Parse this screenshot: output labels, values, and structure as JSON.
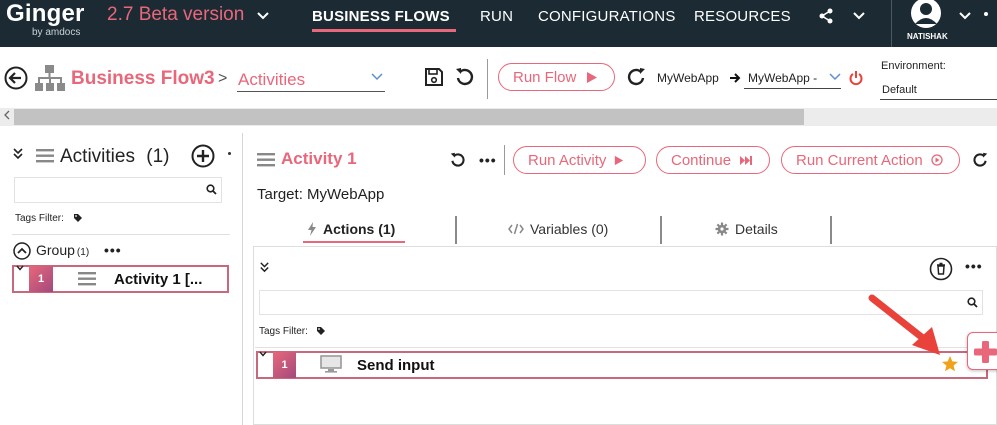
{
  "app": {
    "name": "Ginger",
    "sub": "by amdocs",
    "version": "2.7 Beta version"
  },
  "nav": {
    "business_flows": "BUSINESS FLOWS",
    "run": "RUN",
    "configurations": "CONFIGURATIONS",
    "resources": "RESOURCES"
  },
  "user": {
    "name": "NATISHAK"
  },
  "toolbar": {
    "title": "Business Flow3",
    "separator": ">",
    "page": "Activities",
    "run_flow": "Run Flow",
    "app": "MyWebApp",
    "target_app": "MyWebApp -",
    "env_label": "Environment:",
    "env_value": "Default"
  },
  "left_panel": {
    "title": "Activities",
    "count": "(1)",
    "tags_filter": "Tags Filter:",
    "group_label": "Group",
    "group_count": "(1)",
    "group_more": "•••",
    "activity": {
      "num": "1",
      "label": "Activity 1 [..."
    }
  },
  "right_panel": {
    "title": "Activity 1",
    "more": "•••",
    "run_activity": "Run Activity",
    "continue": "Continue",
    "run_current": "Run Current Action",
    "target": "Target: MyWebApp",
    "tabs": {
      "actions": "Actions (1)",
      "variables": "Variables (0)",
      "details": "Details"
    },
    "tags_filter": "Tags Filter:",
    "more2": "•••",
    "action": {
      "num": "1",
      "label": "Send input"
    }
  },
  "colors": {
    "accent": "#e8677a",
    "topbar": "#1c2b33",
    "star": "#f0a21b",
    "arrow": "#e8423a"
  }
}
